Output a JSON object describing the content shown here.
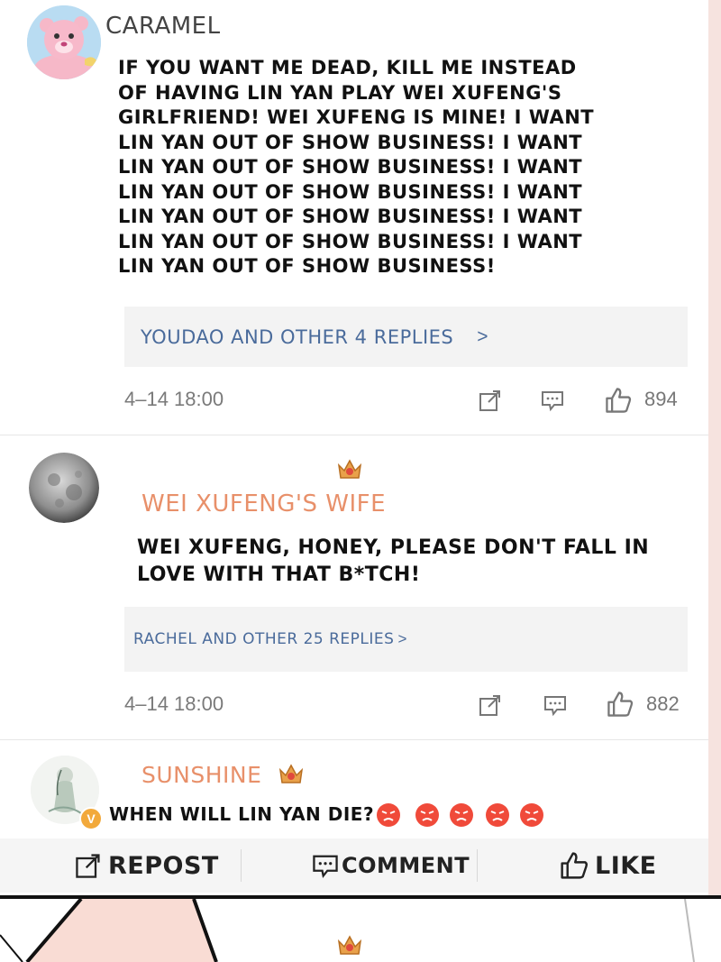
{
  "colors": {
    "username_default": "#444444",
    "username_vip": "#e8906a",
    "replies_link": "#4a6b9b",
    "timestamp": "#7a7a7a",
    "crown": "#e9a14a"
  },
  "posts": [
    {
      "username": "CARAMEL",
      "avatar": "care-bear-avatar",
      "text": "IF YOU WANT ME DEAD, KILL ME INSTEAD OF HAVING LIN YAN PLAY WEI XUFENG'S GIRLFRIEND! WEI XUFENG IS MINE! I WANT LIN YAN OUT OF SHOW BUSINESS! I WANT LIN YAN OUT OF SHOW BUSINESS! I WANT LIN YAN OUT OF SHOW BUSINESS! I WANT LIN YAN OUT OF SHOW BUSINESS! I WANT LIN YAN OUT OF SHOW BUSINESS! I WANT LIN YAN OUT OF SHOW BUSINESS!",
      "replies": "YOUDAO AND OTHER 4 REPLIES",
      "replies_arrow": ">",
      "timestamp": "4–14 18:00",
      "likes": "894"
    },
    {
      "username": "WEI XUFENG'S WIFE",
      "avatar": "moon-avatar",
      "text": "WEI XUFENG, HONEY, PLEASE DON'T FALL IN LOVE WITH THAT B*TCH!",
      "replies": "RACHEL AND OTHER 25 REPLIES",
      "replies_arrow": ">",
      "timestamp": "4–14 18:00",
      "likes": "882"
    },
    {
      "username": "SUNSHINE",
      "avatar": "girl-sketch-avatar",
      "verified": "V",
      "text": "WHEN WILL LIN YAN DIE?"
    }
  ],
  "actions": {
    "repost": "REPOST",
    "comment": "COMMENT",
    "like": "LIKE"
  }
}
